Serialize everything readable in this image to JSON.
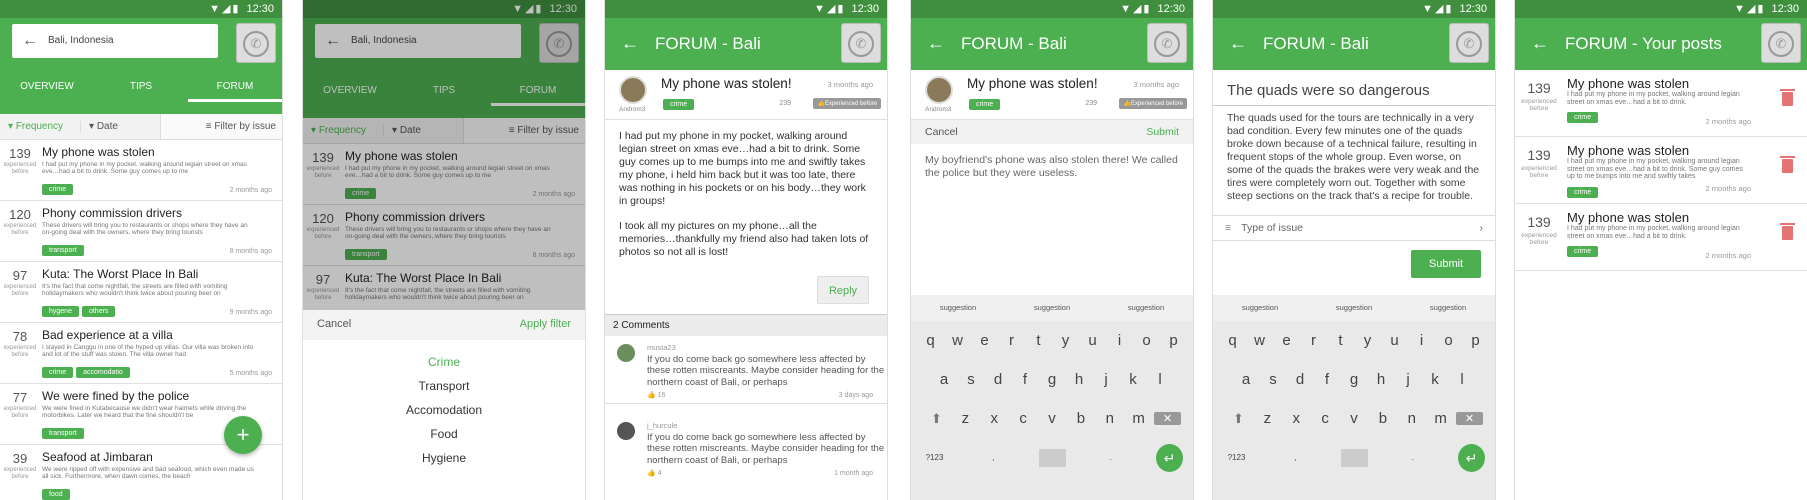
{
  "status": {
    "time": "12:30",
    "icons": "▼◢▮"
  },
  "screen1": {
    "search_value": "Bali, Indonesia",
    "tabs": [
      "OVERVIEW",
      "TIPS",
      "FORUM"
    ],
    "filters": {
      "frequency": "Frequency",
      "date": "Date",
      "issue": "Filter by issue"
    },
    "items": [
      {
        "num": "139",
        "exp": "experienced before",
        "title": "My phone was stolen",
        "desc": "I had put my phone in my pocket, walking around legian street on xmas eve…had a bit to drink. Some guy comes up to me",
        "tags": [
          "crime"
        ],
        "when": "2 months ago"
      },
      {
        "num": "120",
        "exp": "experienced before",
        "title": "Phony commission drivers",
        "desc": "These drivers will bring you to restaurants or shops where they have an on-going deal with the owners, where they bring tourists",
        "tags": [
          "transport"
        ],
        "when": "8 months ago"
      },
      {
        "num": "97",
        "exp": "experienced before",
        "title": "Kuta: The Worst Place In Bali",
        "desc": "It's the fact that come nightfall, the streets are filled with vomiting holidaymakers who wouldn't think twice about pouring beer on",
        "tags": [
          "hygene",
          "others"
        ],
        "when": "9 months ago"
      },
      {
        "num": "78",
        "exp": "experienced before",
        "title": "Bad experience at a villa",
        "desc": "I stayed in Canggu in one of the hyped up villas. Our villa was broken into and lot of the stuff was stolen. The villa owner had",
        "tags": [
          "crime",
          "accomodatio"
        ],
        "when": "5 months ago"
      },
      {
        "num": "77",
        "exp": "experienced before",
        "title": "We were fined by the police",
        "desc": "We were fined in Kutabecause we didn't wear haimets while driving the motorbikes. Later we heard that the fine shouldn't be",
        "tags": [
          "transport"
        ],
        "when": ""
      },
      {
        "num": "39",
        "exp": "experienced before",
        "title": "Seafood at Jimbaran",
        "desc": "We were ripped off with expensive and bad seafood, which even made us all sick. Furthermore, when dawn comes, the beach",
        "tags": [
          "food"
        ],
        "when": ""
      }
    ],
    "fab": "+"
  },
  "screen2": {
    "search_value": "Bali, Indonesia",
    "tabs": [
      "OVERVIEW",
      "TIPS",
      "FORUM"
    ],
    "filters": {
      "frequency": "Frequency",
      "date": "Date",
      "issue": "Filter by issue"
    },
    "items": [
      {
        "num": "139",
        "exp": "experienced before",
        "title": "My phone was stolen",
        "desc": "I had put my phone in my pocket, walking around legian street on xmas eve…had a bit to drink. Some guy comes up to me",
        "tags": [
          "crime"
        ],
        "when": "2 months ago"
      },
      {
        "num": "120",
        "exp": "experienced before",
        "title": "Phony commission drivers",
        "desc": "These drivers will bring you to restaurants or shops where they have an on-going deal with the owners, where they bring tourists",
        "tags": [
          "transport"
        ],
        "when": "8 months ago"
      },
      {
        "num": "97",
        "exp": "experienced before",
        "title": "Kuta: The Worst Place In Bali",
        "desc": "It's the fact that come nightfall, the streets are filled with vomiting holidaymakers who wouldn't think twice about pouring beer on",
        "tags": [],
        "when": ""
      }
    ],
    "cancel": "Cancel",
    "apply": "Apply filter",
    "options": [
      "Crime",
      "Transport",
      "Accomodation",
      "Food",
      "Hygiene"
    ]
  },
  "forum": {
    "title": "FORUM - Bali"
  },
  "post": {
    "author": "Androm3",
    "title": "My phone was stolen!",
    "ago": "3 months ago",
    "tag": "crime",
    "count": "239",
    "badge": "Experienced before",
    "body": [
      "I had put my phone in my pocket, walking around legian street on xmas eve…had a bit to drink. Some guy comes up to me bumps into me and swiftly takes my phone, i held him back but it was too late, there was nothing in his pockets or on his body…they work in groups!",
      "I took all my pictures on my phone…all the memories…thankfully my friend also had taken lots of photos so not all is lost!"
    ],
    "reply": "Reply",
    "comments_header": "2 Comments",
    "comments": [
      {
        "name": "musta23",
        "text": "If you do come back go somewhere less affected by these rotten miscreants. Maybe consider heading for the northern coast of Bali, or perhaps",
        "likes": "16",
        "when": "3 days ago"
      },
      {
        "name": "j_hurcule",
        "text": "If you do come back go somewhere less affected by these rotten miscreants. Maybe consider heading for the northern coast of Bali, or perhaps",
        "likes": "4",
        "when": "1 month ago"
      }
    ]
  },
  "reply_screen": {
    "cancel": "Cancel",
    "submit": "Submit",
    "text": "My boyfriend's phone was also stolen there! We called the police but they were useless."
  },
  "keyboard": {
    "suggestions": [
      "suggestion",
      "suggestion",
      "suggestion"
    ],
    "row1": [
      "q",
      "w",
      "e",
      "r",
      "t",
      "y",
      "u",
      "i",
      "o",
      "p"
    ],
    "row2": [
      "a",
      "s",
      "d",
      "f",
      "g",
      "h",
      "j",
      "k",
      "l"
    ],
    "row3": [
      "z",
      "x",
      "c",
      "v",
      "b",
      "n",
      "m"
    ],
    "sym": "?123",
    "comma": ",",
    "period": "."
  },
  "new_issue": {
    "title": "The quads were so dangerous",
    "body": "The quads used for the tours are technically in a very bad condition. Every few minutes one of the quads broke down because of a technical failure, resulting in frequent stops of the whole group. Even worse, on some of the quads the brakes were very weak and the tires were completely worn out. Together with some steep sections on the track that's a recipe for trouble.",
    "type_placeholder": "Type of issue",
    "submit": "Submit"
  },
  "your_posts": {
    "title": "FORUM - Your posts",
    "items": [
      {
        "num": "139",
        "exp": "experienced before",
        "title": "My phone was stolen",
        "desc": "I had put my phone in my pocket, walking around legian street on xmas eve…had a bit to drink.",
        "tag": "crime",
        "when": "2 months ago"
      },
      {
        "num": "139",
        "exp": "experienced before",
        "title": "My phone was stolen",
        "desc": "I had put my phone in my pocket, walking around legian street on xmas eve…had a bit to drink. Some guy comes up to me bumps into me and swiftly takes",
        "tag": "crime",
        "when": "2 months ago"
      },
      {
        "num": "139",
        "exp": "experienced before",
        "title": "My phone was stolen",
        "desc": "I had put my phone in my pocket, walking around legian street on xmas eve…had a bit to drink.",
        "tag": "crime",
        "when": "2 months ago"
      }
    ]
  },
  "colors": {
    "primary": "#4caf50",
    "statusbar": "#3f8f3f",
    "danger": "#e57373"
  }
}
